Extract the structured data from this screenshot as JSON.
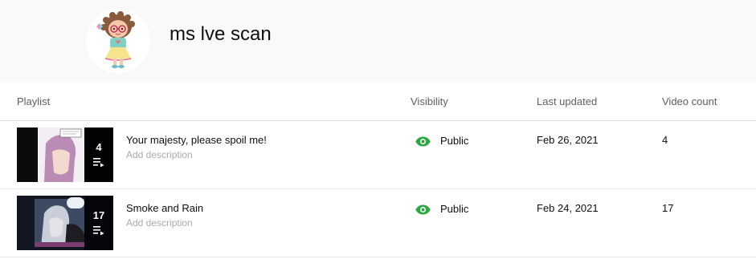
{
  "channel": {
    "name": "ms lve scan",
    "avatar_icon": "chibi-girl-avatar"
  },
  "table": {
    "headers": {
      "playlist": "Playlist",
      "visibility": "Visibility",
      "last_updated": "Last updated",
      "video_count": "Video count"
    },
    "rows": [
      {
        "title": "Your majesty, please spoil me!",
        "description": "Add description",
        "visibility": "Public",
        "last_updated": "Feb 26, 2021",
        "video_count": "4",
        "thumb_count": "4"
      },
      {
        "title": "Smoke and Rain",
        "description": "Add description",
        "visibility": "Public",
        "last_updated": "Feb 24, 2021",
        "video_count": "17",
        "thumb_count": "17"
      }
    ]
  },
  "colors": {
    "header_bg": "#f9f9f9",
    "visibility_green": "#2ba640",
    "muted_text": "#606060",
    "placeholder_text": "#aaaaaa"
  }
}
